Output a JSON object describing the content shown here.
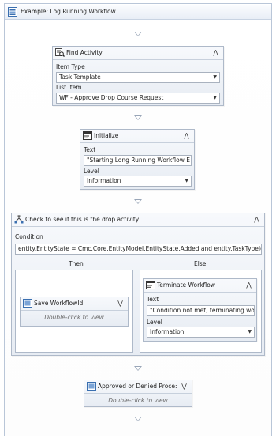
{
  "workflow": {
    "title": "Example: Log Running Workflow"
  },
  "find_activity": {
    "title": "Find Activity",
    "item_type_label": "Item Type",
    "item_type_value": "Task Template",
    "list_item_label": "List Item",
    "list_item_value": "WF - Approve Drop Course Request"
  },
  "initialize": {
    "title": "Initialize",
    "text_label": "Text",
    "text_value": "\"Starting Long Running Workflow E",
    "level_label": "Level",
    "level_value": "Information"
  },
  "if_activity": {
    "title": "Check to see if this is the drop activity",
    "condition_label": "Condition",
    "condition_value": "entity.EntityState = Cmc.Core.EntityModel.EntityState.Added and entity.TaskTypeId",
    "then_label": "Then",
    "else_label": "Else",
    "save_activity": {
      "title": "Save WorkflowId",
      "hint": "Double-click to view"
    },
    "terminate": {
      "title": "Terminate Workflow",
      "text_label": "Text",
      "text_value": "\"Condition not met, terminating wo",
      "level_label": "Level",
      "level_value": "Information"
    }
  },
  "approved_activity": {
    "title": "Approved or Denied Proce:",
    "hint": "Double-click to view"
  },
  "icons": {
    "collapse": "double-chevron-up-icon",
    "expand": "double-chevron-down-icon",
    "dropdown": "triangle-down-icon"
  }
}
